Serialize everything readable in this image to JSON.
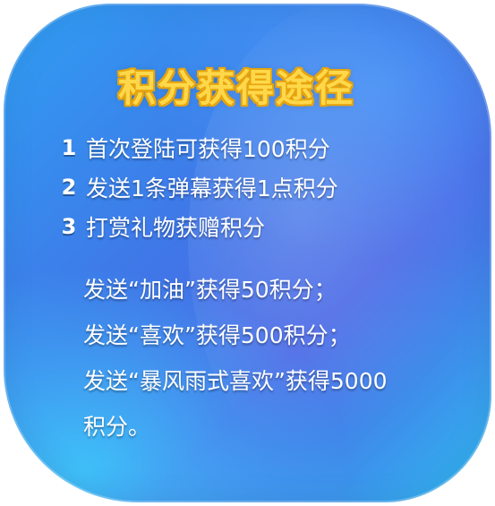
{
  "title": "积分获得途径",
  "items": [
    {
      "number": "1",
      "text": "首次登陆可获得100积分"
    },
    {
      "number": "2",
      "text": "发送1条弹幕获得1点积分"
    },
    {
      "number": "3",
      "text": "打赏礼物获赠积分"
    }
  ],
  "details": [
    "发送“加油”获得50积分；",
    "发送“喜欢”获得500积分；",
    "发送“暴风雨式喜欢”获得5000",
    "积分。"
  ],
  "colors": {
    "title": "#ffd84a",
    "title_outline": "#e6a40f",
    "text": "#ffffff",
    "card_primary": "#3f78e8",
    "card_secondary": "#2fb9f0"
  }
}
